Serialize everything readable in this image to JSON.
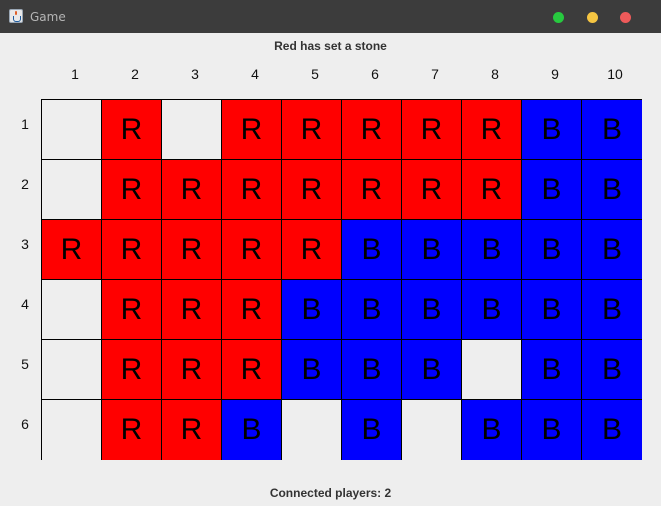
{
  "window": {
    "title": "Game"
  },
  "status_top": "Red has set a stone",
  "status_bottom": "Connected players: 2",
  "column_headers": [
    "1",
    "2",
    "3",
    "4",
    "5",
    "6",
    "7",
    "8",
    "9",
    "10"
  ],
  "row_headers": [
    "1",
    "2",
    "3",
    "4",
    "5",
    "6"
  ],
  "colors": {
    "R": "#ff0000",
    "B": "#0000ff",
    "empty": "#eeeeee"
  },
  "board": [
    [
      "",
      "R",
      "",
      "R",
      "R",
      "R",
      "R",
      "R",
      "B",
      "B"
    ],
    [
      "",
      "R",
      "R",
      "R",
      "R",
      "R",
      "R",
      "R",
      "B",
      "B"
    ],
    [
      "R",
      "R",
      "R",
      "R",
      "R",
      "B",
      "B",
      "B",
      "B",
      "B"
    ],
    [
      "",
      "R",
      "R",
      "R",
      "B",
      "B",
      "B",
      "B",
      "B",
      "B"
    ],
    [
      "",
      "R",
      "R",
      "R",
      "B",
      "B",
      "B",
      "",
      "B",
      "B"
    ],
    [
      "",
      "R",
      "R",
      "B",
      "",
      "B",
      "",
      "B",
      "B",
      "B"
    ]
  ]
}
